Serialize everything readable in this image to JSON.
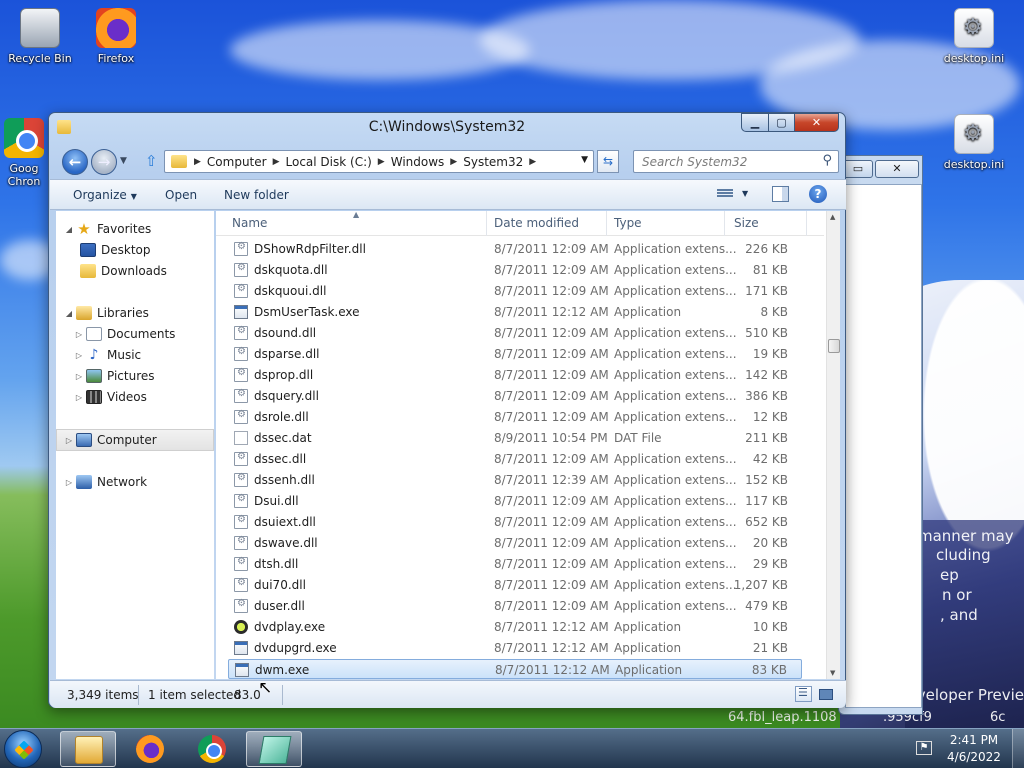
{
  "desktop": {
    "icons": [
      {
        "label": "Recycle Bin"
      },
      {
        "label": "Firefox"
      },
      {
        "label": "Goog Chron"
      },
      {
        "label": "desktop.ini"
      },
      {
        "label": "desktop.ini"
      }
    ],
    "background_text": [
      "manner may",
      "cluding",
      "ep",
      "n or",
      ", and",
      "Developer Previe",
      "64.fbl_leap.1108",
      ".959cf9",
      "6c"
    ]
  },
  "window": {
    "title": "C:\\Windows\\System32",
    "breadcrumb": [
      "Computer",
      "Local Disk (C:)",
      "Windows",
      "System32"
    ],
    "search_placeholder": "Search System32",
    "toolbar": {
      "organize": "Organize",
      "open": "Open",
      "new_folder": "New folder"
    },
    "nav": {
      "favorites": "Favorites",
      "desktop": "Desktop",
      "downloads": "Downloads",
      "libraries": "Libraries",
      "documents": "Documents",
      "music": "Music",
      "pictures": "Pictures",
      "videos": "Videos",
      "computer": "Computer",
      "network": "Network"
    },
    "columns": {
      "name": "Name",
      "date": "Date modified",
      "type": "Type",
      "size": "Size"
    },
    "files": [
      {
        "name": "DShowRdpFilter.dll",
        "date": "8/7/2011 12:09 AM",
        "type": "Application extens...",
        "size": "226 KB",
        "icon": "dll"
      },
      {
        "name": "dskquota.dll",
        "date": "8/7/2011 12:09 AM",
        "type": "Application extens...",
        "size": "81 KB",
        "icon": "dll"
      },
      {
        "name": "dskquoui.dll",
        "date": "8/7/2011 12:09 AM",
        "type": "Application extens...",
        "size": "171 KB",
        "icon": "dll"
      },
      {
        "name": "DsmUserTask.exe",
        "date": "8/7/2011 12:12 AM",
        "type": "Application",
        "size": "8 KB",
        "icon": "exe"
      },
      {
        "name": "dsound.dll",
        "date": "8/7/2011 12:09 AM",
        "type": "Application extens...",
        "size": "510 KB",
        "icon": "dll"
      },
      {
        "name": "dsparse.dll",
        "date": "8/7/2011 12:09 AM",
        "type": "Application extens...",
        "size": "19 KB",
        "icon": "dll"
      },
      {
        "name": "dsprop.dll",
        "date": "8/7/2011 12:09 AM",
        "type": "Application extens...",
        "size": "142 KB",
        "icon": "dll"
      },
      {
        "name": "dsquery.dll",
        "date": "8/7/2011 12:09 AM",
        "type": "Application extens...",
        "size": "386 KB",
        "icon": "dll"
      },
      {
        "name": "dsrole.dll",
        "date": "8/7/2011 12:09 AM",
        "type": "Application extens...",
        "size": "12 KB",
        "icon": "dll"
      },
      {
        "name": "dssec.dat",
        "date": "8/9/2011 10:54 PM",
        "type": "DAT File",
        "size": "211 KB",
        "icon": "dat"
      },
      {
        "name": "dssec.dll",
        "date": "8/7/2011 12:09 AM",
        "type": "Application extens...",
        "size": "42 KB",
        "icon": "dll"
      },
      {
        "name": "dssenh.dll",
        "date": "8/7/2011 12:39 AM",
        "type": "Application extens...",
        "size": "152 KB",
        "icon": "dll"
      },
      {
        "name": "Dsui.dll",
        "date": "8/7/2011 12:09 AM",
        "type": "Application extens...",
        "size": "117 KB",
        "icon": "dll"
      },
      {
        "name": "dsuiext.dll",
        "date": "8/7/2011 12:09 AM",
        "type": "Application extens...",
        "size": "652 KB",
        "icon": "dll"
      },
      {
        "name": "dswave.dll",
        "date": "8/7/2011 12:09 AM",
        "type": "Application extens...",
        "size": "20 KB",
        "icon": "dll"
      },
      {
        "name": "dtsh.dll",
        "date": "8/7/2011 12:09 AM",
        "type": "Application extens...",
        "size": "29 KB",
        "icon": "dll"
      },
      {
        "name": "dui70.dll",
        "date": "8/7/2011 12:09 AM",
        "type": "Application extens...",
        "size": "1,207 KB",
        "icon": "dll"
      },
      {
        "name": "duser.dll",
        "date": "8/7/2011 12:09 AM",
        "type": "Application extens...",
        "size": "479 KB",
        "icon": "dll"
      },
      {
        "name": "dvdplay.exe",
        "date": "8/7/2011 12:12 AM",
        "type": "Application",
        "size": "10 KB",
        "icon": "dvd"
      },
      {
        "name": "dvdupgrd.exe",
        "date": "8/7/2011 12:12 AM",
        "type": "Application",
        "size": "21 KB",
        "icon": "exe"
      },
      {
        "name": "dwm.exe",
        "date": "8/7/2011 12:12 AM",
        "type": "Application",
        "size": "83 KB",
        "icon": "exe",
        "selected": true
      }
    ],
    "status": {
      "items": "3,349 items",
      "selected": "1 item selected",
      "size": "83.0"
    }
  },
  "taskbar": {
    "time": "2:41 PM",
    "date": "4/6/2022"
  },
  "colors": {
    "accent": "#2a67c5",
    "selection": "#cbe2fa",
    "close": "#c7462a"
  }
}
